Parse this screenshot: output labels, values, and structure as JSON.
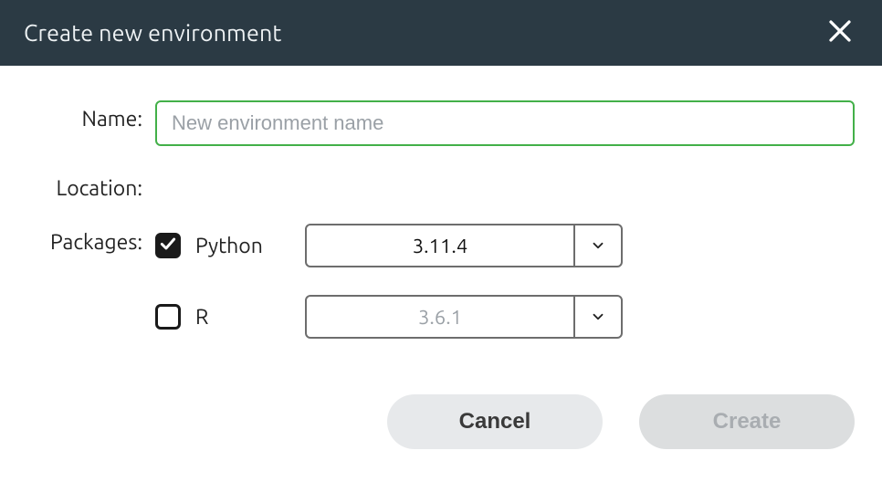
{
  "titlebar": {
    "title": "Create new environment"
  },
  "form": {
    "name_label": "Name:",
    "name_placeholder": "New environment name",
    "name_value": "",
    "location_label": "Location:",
    "location_value": "",
    "packages_label": "Packages:"
  },
  "packages": {
    "python": {
      "label": "Python",
      "checked": true,
      "version": "3.11.4"
    },
    "r": {
      "label": "R",
      "checked": false,
      "version": "3.6.1"
    }
  },
  "buttons": {
    "cancel": "Cancel",
    "create": "Create"
  },
  "colors": {
    "header_bg": "#2b3a44",
    "input_focus_border": "#43b049"
  }
}
